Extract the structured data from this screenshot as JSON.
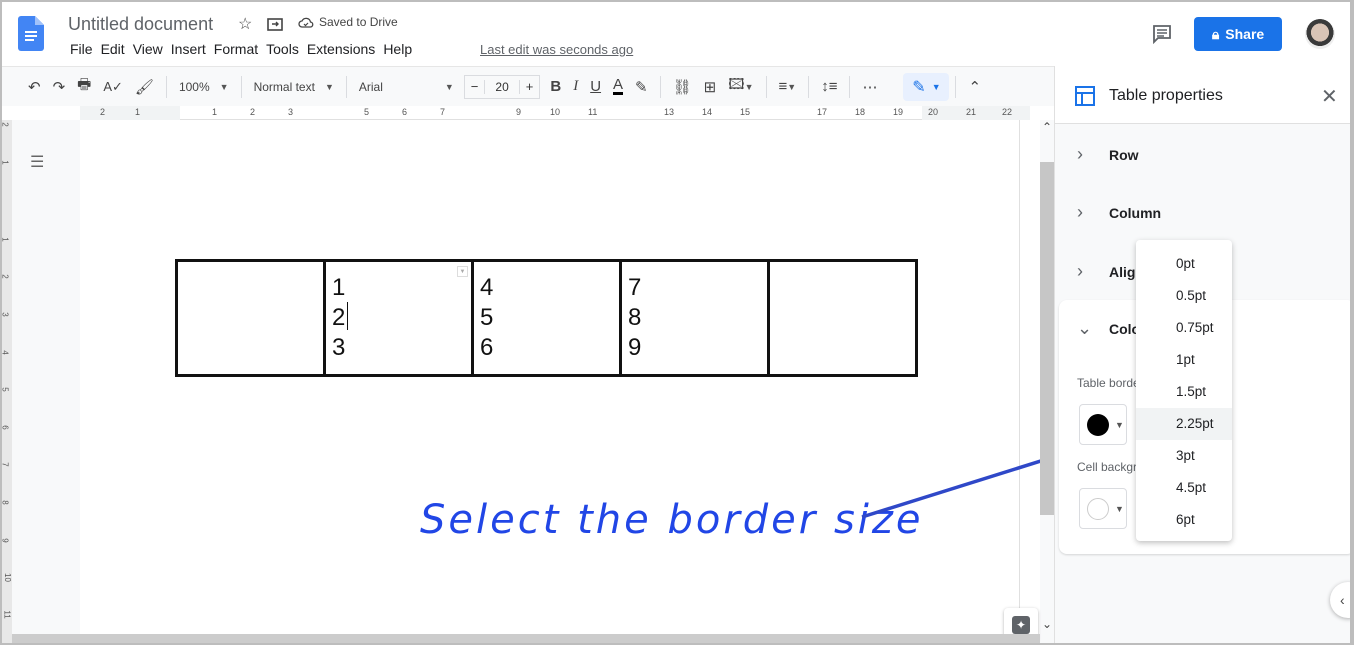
{
  "header": {
    "title": "Untitled document",
    "saved_status": "Saved to Drive",
    "last_edit": "Last edit was seconds ago",
    "share_label": "Share",
    "menu": [
      "File",
      "Edit",
      "View",
      "Insert",
      "Format",
      "Tools",
      "Extensions",
      "Help"
    ]
  },
  "toolbar": {
    "zoom": "100%",
    "style": "Normal text",
    "font": "Arial",
    "font_size": "20",
    "minus": "−",
    "plus": "+",
    "more": "⋯"
  },
  "ruler": {
    "labels": [
      "2",
      "1",
      "1",
      "2",
      "3",
      "5",
      "6",
      "7",
      "9",
      "10",
      "11",
      "13",
      "14",
      "15",
      "17",
      "18",
      "19",
      "20",
      "21",
      "22"
    ]
  },
  "vruler": {
    "labels": [
      "2",
      "1",
      "1",
      "2",
      "3",
      "4",
      "5",
      "6",
      "7",
      "8",
      "9",
      "10",
      "11"
    ]
  },
  "document": {
    "table": [
      [
        [],
        [
          "1",
          "2",
          "3"
        ],
        [
          "4",
          "5",
          "6"
        ],
        [
          "7",
          "8",
          "9"
        ],
        []
      ]
    ]
  },
  "annotation": {
    "text": "Select the border size",
    "color": "#2146e6"
  },
  "panel": {
    "title": "Table properties",
    "sections": [
      "Row",
      "Column",
      "Alignment",
      "Color"
    ],
    "table_border_label": "Table border",
    "cell_background_label": "Cell background",
    "border_color": "#000000",
    "background_color": "#ffffff"
  },
  "border_menu": {
    "options": [
      "0pt",
      "0.5pt",
      "0.75pt",
      "1pt",
      "1.5pt",
      "2.25pt",
      "3pt",
      "4.5pt",
      "6pt"
    ],
    "highlighted": "2.25pt"
  },
  "colors": {
    "accent": "#1a73e8",
    "doc_icon": "#4285f4"
  }
}
